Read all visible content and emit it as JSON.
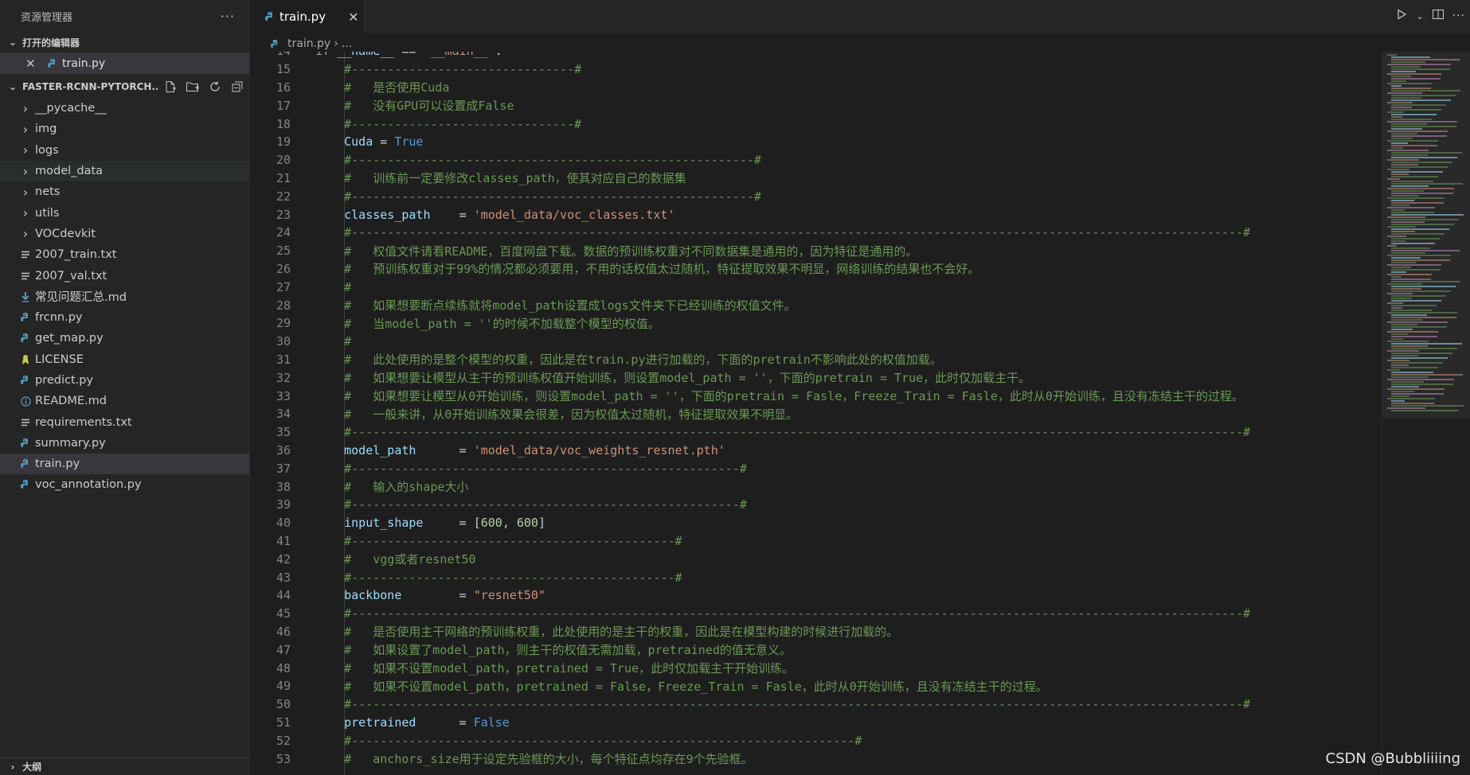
{
  "explorer": {
    "title": "资源管理器",
    "more_icon": "···",
    "open_editors_label": "打开的编辑器",
    "open_editors": [
      {
        "name": "train.py"
      }
    ],
    "project_name": "FASTER-RCNN-PYTORCH...",
    "items": [
      {
        "name": "__pycache__",
        "type": "folder"
      },
      {
        "name": "img",
        "type": "folder"
      },
      {
        "name": "logs",
        "type": "folder"
      },
      {
        "name": "model_data",
        "type": "folder"
      },
      {
        "name": "nets",
        "type": "folder"
      },
      {
        "name": "utils",
        "type": "folder"
      },
      {
        "name": "VOCdevkit",
        "type": "folder"
      },
      {
        "name": "2007_train.txt",
        "type": "txt"
      },
      {
        "name": "2007_val.txt",
        "type": "txt"
      },
      {
        "name": "常见问题汇总.md",
        "type": "md-down"
      },
      {
        "name": "frcnn.py",
        "type": "py"
      },
      {
        "name": "get_map.py",
        "type": "py"
      },
      {
        "name": "LICENSE",
        "type": "license"
      },
      {
        "name": "predict.py",
        "type": "py"
      },
      {
        "name": "README.md",
        "type": "info"
      },
      {
        "name": "requirements.txt",
        "type": "txt"
      },
      {
        "name": "summary.py",
        "type": "py"
      },
      {
        "name": "train.py",
        "type": "py"
      },
      {
        "name": "voc_annotation.py",
        "type": "py"
      }
    ],
    "outline_label": "大纲"
  },
  "tab": {
    "label": "train.py",
    "close": "✕"
  },
  "breadcrumb": {
    "file": "train.py",
    "rest": "..."
  },
  "lines": [
    {
      "n": "14",
      "text": "if __name__ == \"__main__\":"
    },
    {
      "n": "15",
      "text": "    #-------------------------------#"
    },
    {
      "n": "16",
      "text": "    #   是否使用Cuda"
    },
    {
      "n": "17",
      "text": "    #   没有GPU可以设置成False"
    },
    {
      "n": "18",
      "text": "    #-------------------------------#"
    },
    {
      "n": "19",
      "text": "    Cuda = True"
    },
    {
      "n": "20",
      "text": "    #--------------------------------------------------------#"
    },
    {
      "n": "21",
      "text": "    #   训练前一定要修改classes_path，使其对应自己的数据集"
    },
    {
      "n": "22",
      "text": "    #--------------------------------------------------------#"
    },
    {
      "n": "23",
      "text": "    classes_path    = 'model_data/voc_classes.txt'"
    },
    {
      "n": "24",
      "text": "    #----------------------------------------------------------------------------------------------------------------------------#"
    },
    {
      "n": "25",
      "text": "    #   权值文件请看README，百度网盘下载。数据的预训练权重对不同数据集是通用的，因为特征是通用的。"
    },
    {
      "n": "26",
      "text": "    #   预训练权重对于99%的情况都必须要用，不用的话权值太过随机，特征提取效果不明显，网络训练的结果也不会好。"
    },
    {
      "n": "27",
      "text": "    #"
    },
    {
      "n": "28",
      "text": "    #   如果想要断点续练就将model_path设置成logs文件夹下已经训练的权值文件。"
    },
    {
      "n": "29",
      "text": "    #   当model_path = ''的时候不加载整个模型的权值。"
    },
    {
      "n": "30",
      "text": "    #"
    },
    {
      "n": "31",
      "text": "    #   此处使用的是整个模型的权重，因此是在train.py进行加载的，下面的pretrain不影响此处的权值加载。"
    },
    {
      "n": "32",
      "text": "    #   如果想要让模型从主干的预训练权值开始训练，则设置model_path = ''，下面的pretrain = True，此时仅加载主干。"
    },
    {
      "n": "33",
      "text": "    #   如果想要让模型从0开始训练，则设置model_path = ''，下面的pretrain = Fasle，Freeze_Train = Fasle，此时从0开始训练，且没有冻结主干的过程。"
    },
    {
      "n": "34",
      "text": "    #   一般来讲，从0开始训练效果会很差，因为权值太过随机，特征提取效果不明显。"
    },
    {
      "n": "35",
      "text": "    #----------------------------------------------------------------------------------------------------------------------------#"
    },
    {
      "n": "36",
      "text": "    model_path      = 'model_data/voc_weights_resnet.pth'"
    },
    {
      "n": "37",
      "text": "    #------------------------------------------------------#"
    },
    {
      "n": "38",
      "text": "    #   输入的shape大小"
    },
    {
      "n": "39",
      "text": "    #------------------------------------------------------#"
    },
    {
      "n": "40",
      "text": "    input_shape     = [600, 600]"
    },
    {
      "n": "41",
      "text": "    #---------------------------------------------#"
    },
    {
      "n": "42",
      "text": "    #   vgg或者resnet50"
    },
    {
      "n": "43",
      "text": "    #---------------------------------------------#"
    },
    {
      "n": "44",
      "text": "    backbone        = \"resnet50\""
    },
    {
      "n": "45",
      "text": "    #----------------------------------------------------------------------------------------------------------------------------#"
    },
    {
      "n": "46",
      "text": "    #   是否使用主干网络的预训练权重，此处使用的是主干的权重，因此是在模型构建的时候进行加载的。"
    },
    {
      "n": "47",
      "text": "    #   如果设置了model_path，则主干的权值无需加载，pretrained的值无意义。"
    },
    {
      "n": "48",
      "text": "    #   如果不设置model_path，pretrained = True，此时仅加载主干开始训练。"
    },
    {
      "n": "49",
      "text": "    #   如果不设置model_path，pretrained = False，Freeze_Train = Fasle，此时从0开始训练，且没有冻结主干的过程。"
    },
    {
      "n": "50",
      "text": "    #----------------------------------------------------------------------------------------------------------------------------#"
    },
    {
      "n": "51",
      "text": "    pretrained      = False"
    },
    {
      "n": "52",
      "text": "    #----------------------------------------------------------------------#"
    },
    {
      "n": "53",
      "text": "    #   anchors_size用于设定先验框的大小，每个特征点均存在9个先验框。"
    }
  ],
  "watermark": "CSDN @Bubbliiiing",
  "colors": {
    "background": "#1e1e1e",
    "sidebar": "#252526",
    "comment": "#6a9955",
    "keyword": "#c586c0",
    "variable": "#9cdcfe",
    "string": "#ce9178",
    "boolean": "#569cd6",
    "python_icon": "#519aba"
  }
}
